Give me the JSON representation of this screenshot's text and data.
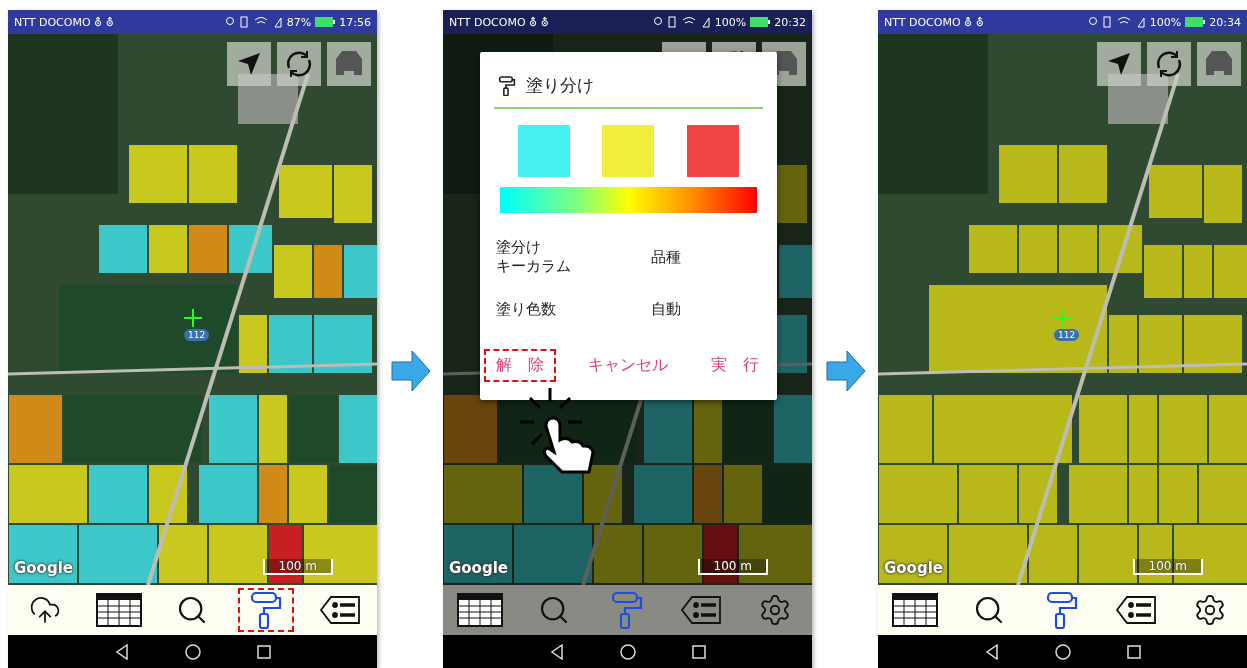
{
  "screens": [
    {
      "status_bar": {
        "carrier": "NTT DOCOMO ⛢ ⛢",
        "battery": "87%",
        "time": "17:56"
      },
      "dimmed": false,
      "painted": true,
      "map": {
        "logo": "Google",
        "scale": "100 m",
        "road_sign": "112"
      },
      "toolbar": [
        {
          "kind": "upload",
          "selected": false,
          "highlighted": false
        },
        {
          "kind": "table",
          "selected": false,
          "highlighted": false
        },
        {
          "kind": "search",
          "selected": false,
          "highlighted": false
        },
        {
          "kind": "paint",
          "selected": true,
          "highlighted": true
        },
        {
          "kind": "tags",
          "selected": false,
          "highlighted": false
        }
      ]
    },
    {
      "status_bar": {
        "carrier": "NTT DOCOMO ⛢ ⛢",
        "battery": "100%",
        "time": "20:32"
      },
      "dimmed": true,
      "painted": true,
      "map": {
        "logo": "Google",
        "scale": "100 m"
      },
      "toolbar": [
        {
          "kind": "table",
          "selected": false,
          "highlighted": false
        },
        {
          "kind": "search",
          "selected": false,
          "highlighted": false
        },
        {
          "kind": "paint",
          "selected": true,
          "highlighted": false
        },
        {
          "kind": "tags",
          "selected": false,
          "highlighted": false
        },
        {
          "kind": "settings",
          "selected": false,
          "highlighted": false
        }
      ],
      "dialog": {
        "title": "塗り分け",
        "swatches": [
          {
            "color": "#45f0f0"
          },
          {
            "color": "#f0f03c"
          },
          {
            "color": "#f04545"
          }
        ],
        "rows": [
          {
            "label": [
              "塗分け",
              "キーカラム"
            ],
            "value": "品種"
          },
          {
            "label": [
              "塗り色数"
            ],
            "value": "自動"
          }
        ],
        "buttons": [
          {
            "label": "解　除",
            "highlighted": true
          },
          {
            "label": "キャンセル",
            "highlighted": false
          },
          {
            "label": "実　行",
            "highlighted": false
          }
        ]
      }
    },
    {
      "status_bar": {
        "carrier": "NTT DOCOMO ⛢ ⛢",
        "battery": "100%",
        "time": "20:34"
      },
      "dimmed": false,
      "painted": false,
      "map": {
        "logo": "Google",
        "scale": "100 m",
        "road_sign": "112"
      },
      "toolbar": [
        {
          "kind": "table",
          "selected": false,
          "highlighted": false
        },
        {
          "kind": "search",
          "selected": false,
          "highlighted": false
        },
        {
          "kind": "paint",
          "selected": true,
          "highlighted": false
        },
        {
          "kind": "tags",
          "selected": false,
          "highlighted": false
        },
        {
          "kind": "settings",
          "selected": false,
          "highlighted": false
        }
      ]
    }
  ]
}
